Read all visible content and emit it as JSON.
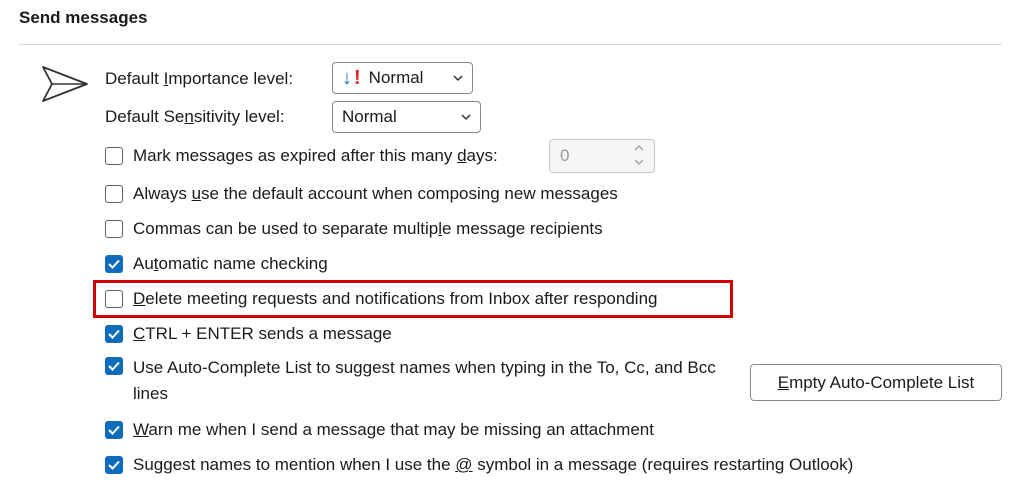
{
  "section": {
    "title": "Send messages"
  },
  "importance": {
    "label_pre": "Default ",
    "label_ul": "I",
    "label_post": "mportance level:",
    "value": "Normal"
  },
  "sensitivity": {
    "label_pre": "Default Se",
    "label_ul": "n",
    "label_post": "sitivity level:",
    "value": "Normal"
  },
  "expire": {
    "label_pre": "Mark messages as expired after this many ",
    "label_ul": "d",
    "label_post": "ays:",
    "value": "0",
    "checked": false
  },
  "options": [
    {
      "pre": "Always ",
      "ul": "u",
      "post": "se the default account when composing new messages",
      "checked": false
    },
    {
      "pre": "Commas can be used to separate multip",
      "ul": "l",
      "post": "e message recipients",
      "checked": false
    },
    {
      "pre": "Au",
      "ul": "t",
      "post": "omatic name checking",
      "checked": true
    },
    {
      "pre": "",
      "ul": "D",
      "post": "elete meeting requests and notifications from Inbox after responding",
      "checked": false
    },
    {
      "pre": "",
      "ul": "C",
      "post": "TRL + ENTER sends a message",
      "checked": true
    },
    {
      "pre": "Use Auto-Complete List to su",
      "ul": "g",
      "post": "gest names when typing in the To, Cc, and Bcc lines",
      "checked": true
    },
    {
      "pre": "",
      "ul": "W",
      "post": "arn me when I send a message that may be missing an attachment",
      "checked": true
    },
    {
      "pre": "Suggest names to mention when I use the ",
      "ul": "@",
      "post": " symbol in a message (requires restarting Outlook)",
      "checked": true
    }
  ],
  "empty_button": {
    "ul": "E",
    "post": "mpty Auto-Complete List"
  },
  "colors": {
    "accent": "#0f6cbd",
    "highlight": "#d40000"
  },
  "icons": {
    "send": "send-icon",
    "importance": "importance-normal-icon",
    "chevron": "chevron-down-icon",
    "check": "checkmark-icon"
  }
}
